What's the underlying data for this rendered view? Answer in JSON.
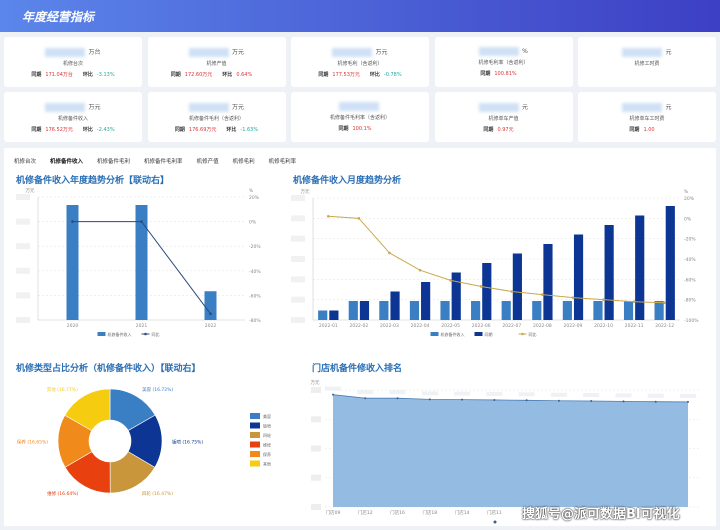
{
  "header": {
    "title": "年度经营指标"
  },
  "kpi_rows": [
    [
      {
        "name": "机修台次",
        "unit": "万台",
        "same_label": "同期",
        "same": "171.04万台",
        "mom_label": "环比",
        "mom": "-3.13%",
        "mom_dir": "down"
      },
      {
        "name": "机修产值",
        "unit": "万元",
        "same_label": "同期",
        "same": "172.60万元",
        "mom_label": "环比",
        "mom": "0.64%",
        "mom_dir": "up"
      },
      {
        "name": "机修毛利（含返利）",
        "unit": "万元",
        "same_label": "同期",
        "same": "177.53万元",
        "mom_label": "环比",
        "mom": "-0.78%",
        "mom_dir": "down"
      },
      {
        "name": "机修毛利率（含返利）",
        "unit": "%",
        "same_label": "同期",
        "same": "100.81%"
      },
      {
        "name": "机修工时费",
        "unit": "元"
      }
    ],
    [
      {
        "name": "机修备件收入",
        "unit": "万元",
        "same_label": "同期",
        "same": "176.52万元",
        "mom_label": "环比",
        "mom": "-2.43%",
        "mom_dir": "down"
      },
      {
        "name": "机修备件毛利（含返利）",
        "unit": "万元",
        "same_label": "同期",
        "same": "176.69万元",
        "mom_label": "环比",
        "mom": "-1.63%",
        "mom_dir": "down"
      },
      {
        "name": "机修备件毛利率（含返利）",
        "unit": "",
        "same_label": "同期",
        "same": "100.1%"
      },
      {
        "name": "机修单车产值",
        "unit": "元",
        "same_label": "同期",
        "same": "0.97元"
      },
      {
        "name": "机修单车工时费",
        "unit": "元",
        "same_label": "同期",
        "same": "1.00"
      }
    ]
  ],
  "tabs": [
    {
      "label": "机修台次"
    },
    {
      "label": "机修备件收入",
      "active": true
    },
    {
      "label": "机修备件毛利"
    },
    {
      "label": "机修备件毛利率"
    },
    {
      "label": "机修产值"
    },
    {
      "label": "机修毛利"
    },
    {
      "label": "机修毛利率"
    }
  ],
  "watermark": "搜狐号@派可数据BI可视化",
  "chart_data": [
    {
      "type": "bar",
      "title": "机修备件收入年度趋势分析【联动右】",
      "left_unit": "万元",
      "right_unit": "%",
      "categories": [
        "2020",
        "2021",
        "2022"
      ],
      "series": [
        {
          "name": "机修备件收入",
          "type": "bar",
          "axis": "left",
          "values": [
            100,
            100,
            25
          ],
          "color": "#3a7fc4"
        },
        {
          "name": "同比",
          "type": "line",
          "axis": "right",
          "values": [
            0,
            0,
            -75
          ],
          "color": "#2c4a7a"
        }
      ],
      "right_ylim": [
        -80,
        20
      ],
      "right_ticks": [
        "20%",
        "0%",
        "-20%",
        "-40%",
        "-60%",
        "-80%"
      ],
      "grid": true,
      "legend": "bottom"
    },
    {
      "type": "bar",
      "title": "机修备件收入月度趋势分析",
      "left_unit": "万元",
      "right_unit": "%",
      "categories": [
        "2022-01",
        "2022-02",
        "2022-03",
        "2022-04",
        "2022-05",
        "2022-06",
        "2022-07",
        "2022-08",
        "2022-09",
        "2022-10",
        "2022-11",
        "2022-12"
      ],
      "series": [
        {
          "name": "机修备件收入",
          "type": "bar",
          "axis": "left",
          "values": [
            1,
            2,
            2,
            2,
            2,
            2,
            2,
            2,
            2,
            2,
            2,
            2
          ],
          "color": "#3a7fc4"
        },
        {
          "name": "同期",
          "type": "bar",
          "axis": "left",
          "values": [
            1,
            2,
            3,
            4,
            5,
            6,
            7,
            8,
            9,
            10,
            11,
            12
          ],
          "color": "#0c3594"
        },
        {
          "name": "同比",
          "type": "line",
          "axis": "right",
          "values": [
            2,
            0,
            -34,
            -51,
            -61,
            -67,
            -72,
            -75,
            -78,
            -80,
            -82,
            -83
          ],
          "color": "#c9a94a"
        }
      ],
      "right_ylim": [
        -100,
        20
      ],
      "right_ticks": [
        "20%",
        "0%",
        "-20%",
        "-40%",
        "-60%",
        "-80%",
        "-100%"
      ],
      "grid": true,
      "legend": "bottom"
    },
    {
      "type": "pie",
      "title": "机修类型占比分析（机修备件收入）【联动右】",
      "slices": [
        {
          "label": "美容",
          "value": 16.72,
          "color": "#3a7fc4"
        },
        {
          "label": "钣喷",
          "value": 16.75,
          "color": "#0c3594"
        },
        {
          "label": "四轮",
          "value": 16.47,
          "color": "#c9963c"
        },
        {
          "label": "维修",
          "value": 16.64,
          "color": "#e8400f"
        },
        {
          "label": "保养",
          "value": 16.65,
          "color": "#f08a1a"
        },
        {
          "label": "其他",
          "value": 16.77,
          "color": "#f5cc10"
        }
      ],
      "legend": "right"
    },
    {
      "type": "area",
      "title": "门店机备件修收入排名",
      "left_unit": "万元",
      "categories": [
        "门店09",
        "门店12",
        "门店16",
        "门店18",
        "门店14",
        "门店11",
        "",
        "",
        "",
        "",
        "",
        ""
      ],
      "values": [
        96,
        93,
        93,
        92,
        91.8,
        91.5,
        91.2,
        90.8,
        90.6,
        90.3,
        90,
        89.8
      ],
      "ylim": [
        0,
        100
      ],
      "color": "#94bce3",
      "grid": true,
      "legend": "bottom"
    }
  ]
}
